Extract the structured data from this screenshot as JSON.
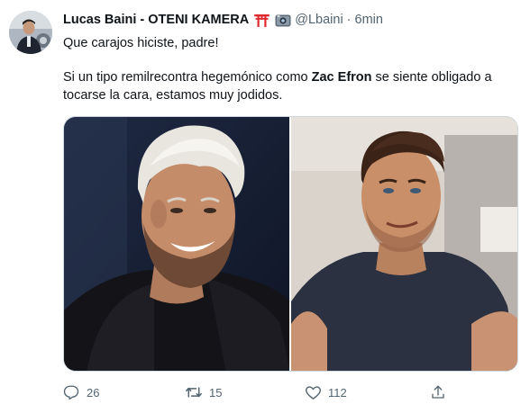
{
  "tweet": {
    "author": {
      "display_name": "Lucas Baini - OTENI KAMERA",
      "badge_icons": [
        "torii-gate-icon",
        "camera-icon"
      ],
      "handle": "@Lbaini",
      "separator": "·",
      "time": "6min",
      "avatar_icon": "avatar-photo"
    },
    "text": {
      "line1": "Que carajos hiciste, padre!",
      "line2_before": "Si un tipo remilrecontra hegemónico como ",
      "line2_bold": "Zac Efron",
      "line2_after": " se siente obligado a tocarse la cara, estamos muy jodidos."
    },
    "media": {
      "images": [
        "photo-left",
        "photo-right"
      ]
    },
    "actions": {
      "replies": "26",
      "retweets": "15",
      "likes": "112",
      "reply_icon": "reply-icon",
      "retweet_icon": "retweet-icon",
      "like_icon": "heart-icon",
      "share_icon": "share-icon"
    }
  },
  "colors": {
    "text": "#0f1419",
    "secondary": "#536471",
    "torii_red": "#e0292e",
    "border": "#cfd9de"
  }
}
